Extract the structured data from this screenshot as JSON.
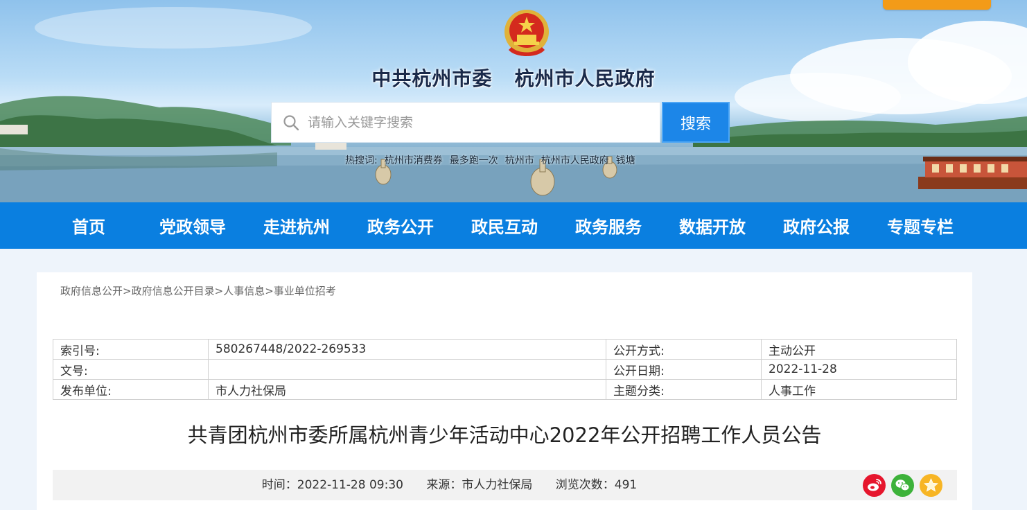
{
  "header": {
    "site_title": "中共杭州市委   杭州市人民政府",
    "emblem_icon": "national-emblem-icon"
  },
  "search": {
    "placeholder": "请输入关键字搜索",
    "button_label": "搜索",
    "hot_label": "热搜词:",
    "hot_words": [
      "杭州市消费券",
      "最多跑一次",
      "杭州市",
      "杭州市人民政府",
      "钱塘"
    ]
  },
  "nav": {
    "items": [
      "首页",
      "党政领导",
      "走进杭州",
      "政务公开",
      "政民互动",
      "政务服务",
      "数据开放",
      "政府公报",
      "专题专栏"
    ]
  },
  "breadcrumb": [
    "政府信息公开",
    "政府信息公开目录",
    "人事信息",
    "事业单位招考"
  ],
  "meta": {
    "index_label": "索引号:",
    "index_value": "580267448/2022-269533",
    "method_label": "公开方式:",
    "method_value": "主动公开",
    "doc_label": "文号:",
    "doc_value": "",
    "date_label": "公开日期:",
    "date_value": "2022-11-28",
    "publisher_label": "发布单位:",
    "publisher_value": "市人力社保局",
    "topic_label": "主题分类:",
    "topic_value": "人事工作"
  },
  "article": {
    "title": "共青团杭州市委所属杭州青少年活动中心2022年公开招聘工作人员公告",
    "time_label": "时间：",
    "time_value": "2022-11-28 09:30",
    "source_label": "来源：",
    "source_value": "市人力社保局",
    "views_label": "浏览次数：",
    "views_value": "491"
  },
  "colors": {
    "nav_bg": "#0a7fe0",
    "search_button": "#1c86e8",
    "weibo": "#e6162d",
    "wechat": "#3db23a",
    "favorite": "#f7b524"
  }
}
